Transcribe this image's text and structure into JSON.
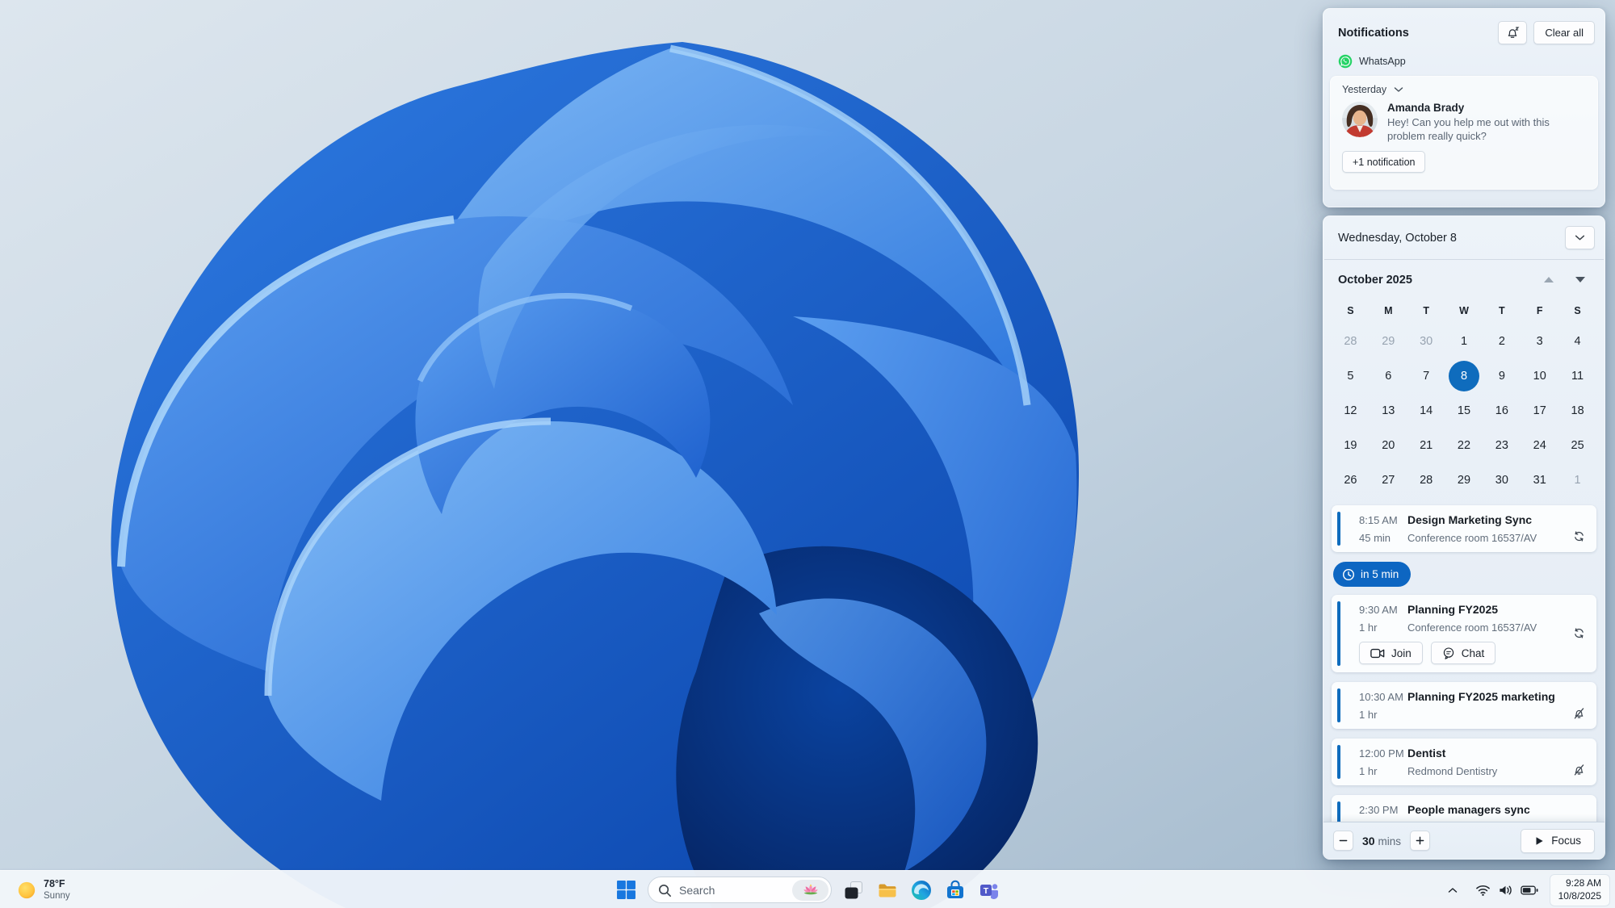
{
  "colors": {
    "accent": "#0F6CBD",
    "reminder_pill_bg": "#0D66C2",
    "selected_day_bg": "#0F6CBD",
    "whatsapp_green": "#25D366",
    "panel_bg": "#E9F0F7",
    "card_bg": "#FBFDFE",
    "taskbar_bg": "#F1F6FA"
  },
  "notifications": {
    "title": "Notifications",
    "clear_all_label": "Clear all",
    "settings_icon": "bell-snooze-icon",
    "group_app": "WhatsApp",
    "section_label": "Yesterday",
    "notification": {
      "sender": "Amanda Brady",
      "message": "Hey! Can you help me out with this problem really quick?",
      "more_label": "+1 notification"
    }
  },
  "calendar": {
    "date_header": "Wednesday, October 8",
    "month_label": "October 2025",
    "day_headers": [
      "S",
      "M",
      "T",
      "W",
      "T",
      "F",
      "S"
    ],
    "selected_day": "8",
    "weeks": [
      [
        {
          "d": "28",
          "dim": true
        },
        {
          "d": "29",
          "dim": true
        },
        {
          "d": "30",
          "dim": true
        },
        {
          "d": "1"
        },
        {
          "d": "2"
        },
        {
          "d": "3"
        },
        {
          "d": "4"
        }
      ],
      [
        {
          "d": "5"
        },
        {
          "d": "6"
        },
        {
          "d": "7"
        },
        {
          "d": "8",
          "sel": true
        },
        {
          "d": "9"
        },
        {
          "d": "10"
        },
        {
          "d": "11"
        }
      ],
      [
        {
          "d": "12"
        },
        {
          "d": "13"
        },
        {
          "d": "14"
        },
        {
          "d": "15"
        },
        {
          "d": "16"
        },
        {
          "d": "17"
        },
        {
          "d": "18"
        }
      ],
      [
        {
          "d": "19"
        },
        {
          "d": "20"
        },
        {
          "d": "21"
        },
        {
          "d": "22"
        },
        {
          "d": "23"
        },
        {
          "d": "24"
        },
        {
          "d": "25"
        }
      ],
      [
        {
          "d": "26"
        },
        {
          "d": "27"
        },
        {
          "d": "28"
        },
        {
          "d": "29"
        },
        {
          "d": "30"
        },
        {
          "d": "31"
        },
        {
          "d": "1",
          "dim": true
        }
      ]
    ]
  },
  "reminder": {
    "label": "in 5 min",
    "icon": "clock-icon"
  },
  "events": [
    {
      "time": "8:15 AM",
      "title": "Design Marketing Sync",
      "duration": "45 min",
      "location": "Conference room 16537/AV",
      "status_icon": "recurring-icon"
    },
    {
      "time": "9:30 AM",
      "title": "Planning FY2025",
      "duration": "1 hr",
      "location": "Conference room 16537/AV",
      "status_icon": "recurring-icon",
      "join_label": "Join",
      "chat_label": "Chat"
    },
    {
      "time": "10:30 AM",
      "title": "Planning FY2025 marketing",
      "duration": "1 hr",
      "status_icon": "reminder-off-icon"
    },
    {
      "time": "12:00 PM",
      "title": "Dentist",
      "duration": "1 hr",
      "location": "Redmond Dentistry",
      "status_icon": "reminder-off-icon"
    },
    {
      "time": "2:30 PM",
      "title": "People managers sync"
    }
  ],
  "focus_bar": {
    "duration_value": "30",
    "duration_unit": "mins",
    "focus_label": "Focus",
    "icons": [
      "minus-icon",
      "plus-icon",
      "play-icon"
    ]
  },
  "taskbar": {
    "weather": {
      "temp": "78°F",
      "condition": "Sunny",
      "icon": "sun-icon"
    },
    "search": {
      "placeholder": "Search",
      "icons": [
        "magnifier-icon",
        "lotus-flower-icon"
      ]
    },
    "apps": [
      "start",
      "task-view",
      "file-explorer",
      "edge",
      "store",
      "teams"
    ],
    "tray": {
      "icons": [
        "chevron-up-icon",
        "wifi-icon",
        "volume-icon",
        "battery-icon"
      ],
      "time": "9:28 AM",
      "date": "10/8/2025"
    }
  }
}
